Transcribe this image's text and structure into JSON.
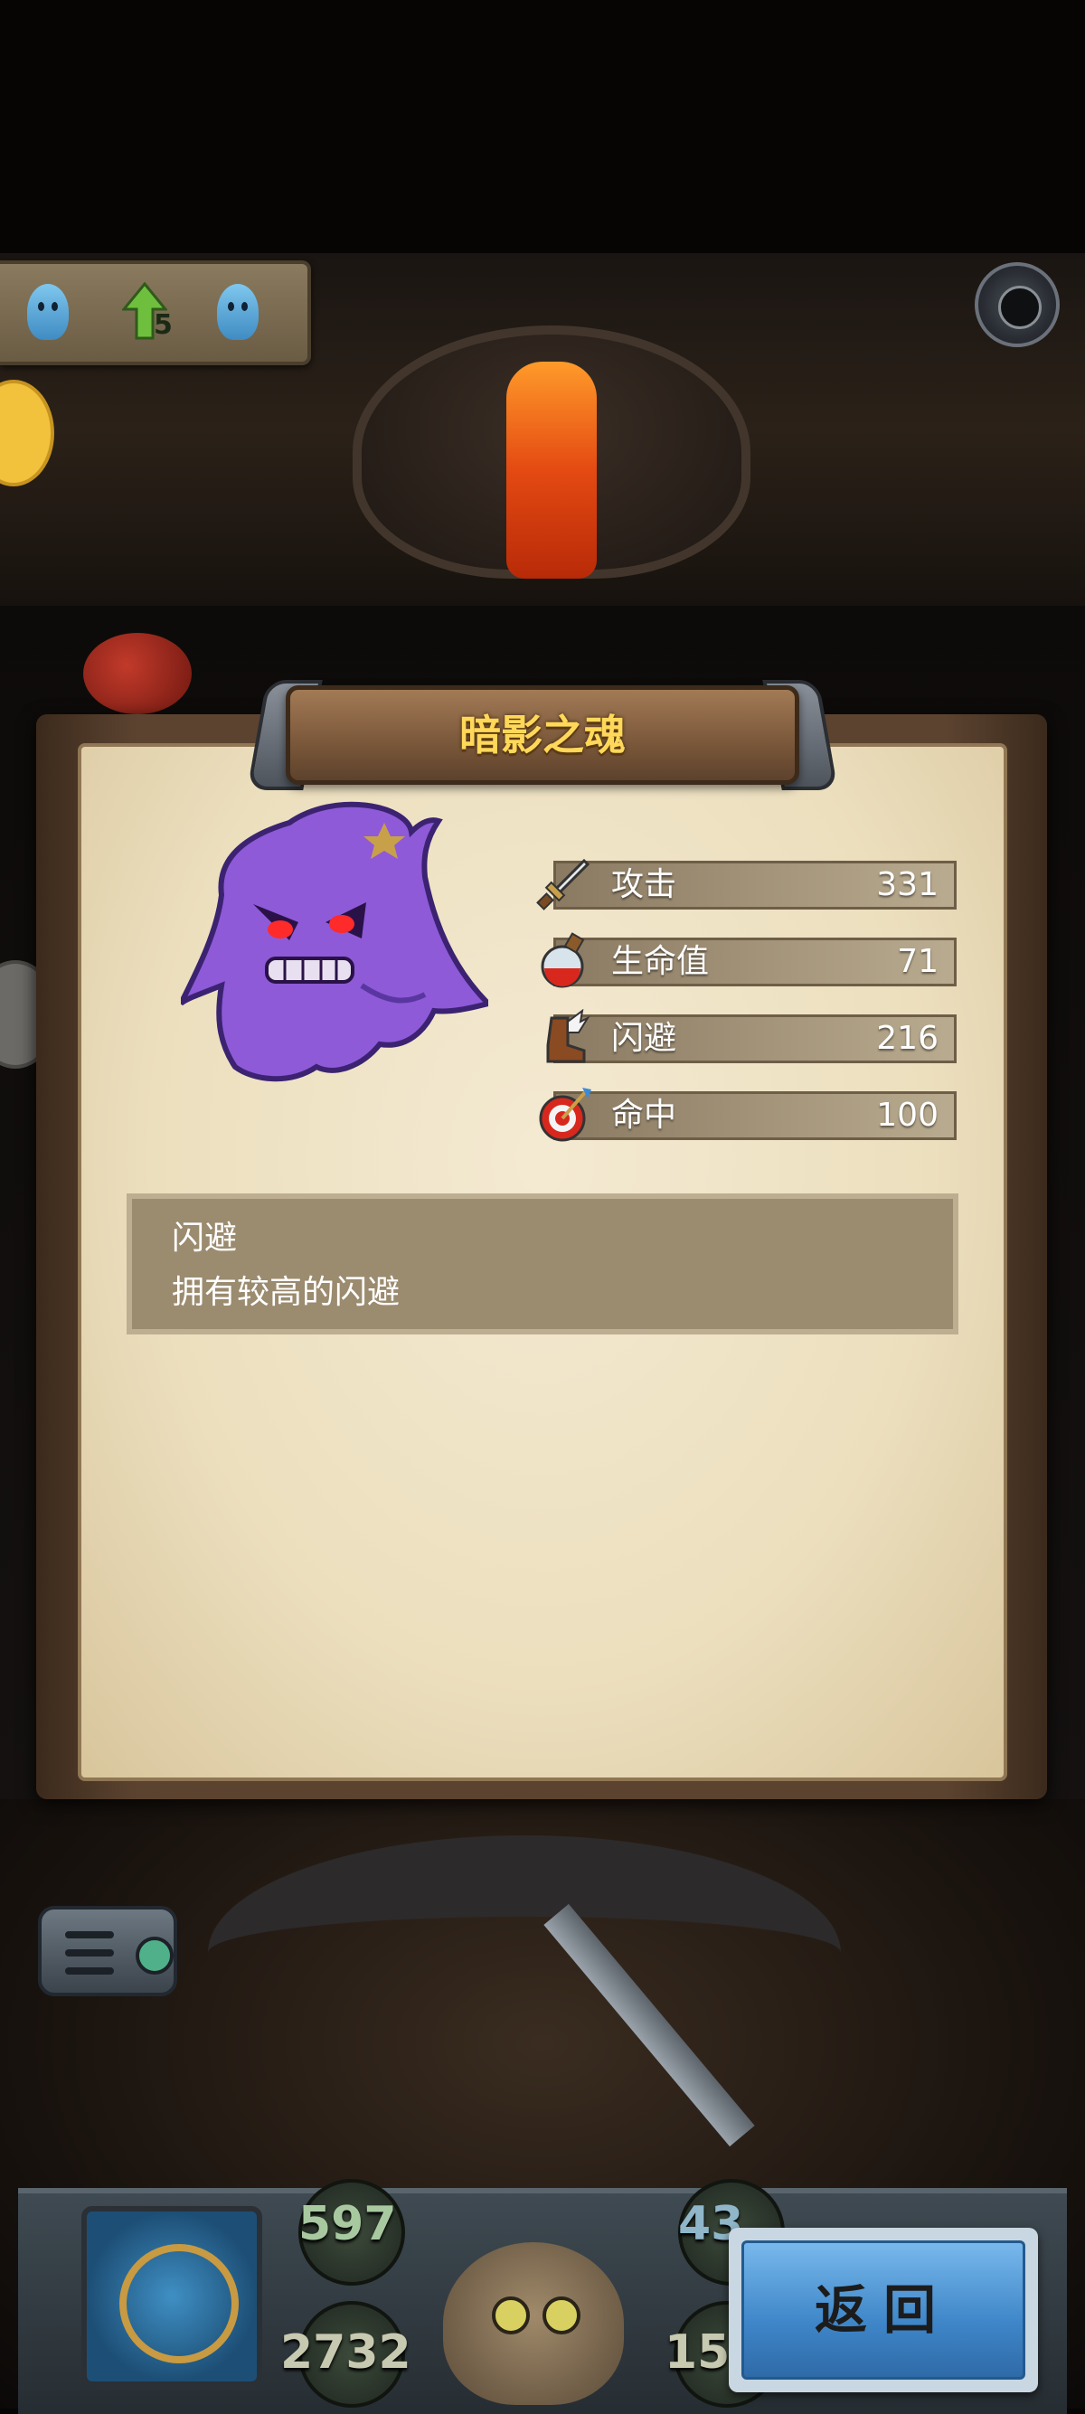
{
  "hud": {
    "level_badge": "5"
  },
  "panel": {
    "title": "暗影之魂",
    "stats": [
      {
        "icon": "sword-icon",
        "label": "攻击",
        "value": "331"
      },
      {
        "icon": "potion-icon",
        "label": "生命值",
        "value": "71"
      },
      {
        "icon": "winged-boot-icon",
        "label": "闪避",
        "value": "216"
      },
      {
        "icon": "target-icon",
        "label": "命中",
        "value": "100"
      }
    ],
    "skill": {
      "name": "闪避",
      "description": "拥有较高的闪避"
    }
  },
  "bottom_bar": {
    "attack_value": "597",
    "gold_value": "2732",
    "right_top_value": "43",
    "right_bottom_value": "15"
  },
  "back_button": {
    "label": "返回"
  },
  "colors": {
    "title_gold": "#ffd85a",
    "ghost_purple": "#8e5ad8",
    "back_button_blue": "#3e86c8"
  }
}
